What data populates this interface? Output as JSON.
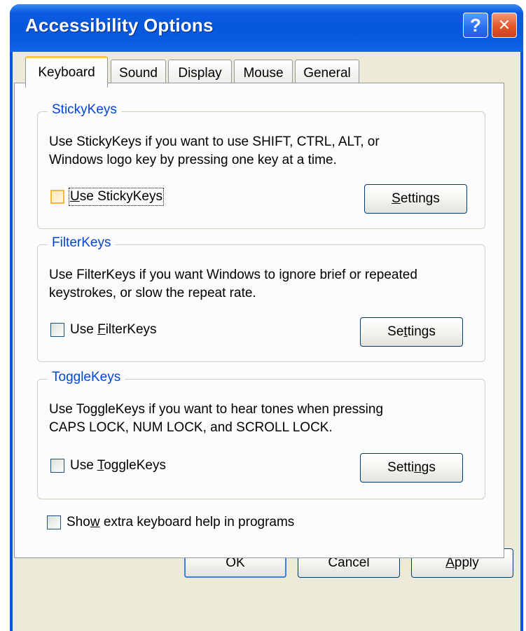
{
  "window": {
    "title": "Accessibility Options"
  },
  "titlebar": {
    "help_glyph": "?",
    "close_glyph": "✕"
  },
  "tabs": [
    {
      "label": "Keyboard",
      "active": true
    },
    {
      "label": "Sound",
      "active": false
    },
    {
      "label": "Display",
      "active": false
    },
    {
      "label": "Mouse",
      "active": false
    },
    {
      "label": "General",
      "active": false
    }
  ],
  "stickykeys": {
    "legend": "StickyKeys",
    "desc_line1": "Use StickyKeys if you want to use SHIFT, CTRL, ALT, or",
    "desc_line2": "Windows logo key by pressing one key at a time.",
    "checkbox": {
      "pre": "",
      "key": "U",
      "post": "se StickyKeys",
      "checked": false
    },
    "settings": {
      "pre": "",
      "key": "S",
      "post": "ettings"
    }
  },
  "filterkeys": {
    "legend": "FilterKeys",
    "desc_line1": "Use FilterKeys if you want Windows to ignore brief or repeated",
    "desc_line2": "keystrokes, or slow the repeat rate.",
    "checkbox": {
      "pre": "Use ",
      "key": "F",
      "post": "ilterKeys",
      "checked": false
    },
    "settings": {
      "pre": "Se",
      "key": "t",
      "post": "tings"
    }
  },
  "togglekeys": {
    "legend": "ToggleKeys",
    "desc_line1": "Use ToggleKeys if you want to hear tones when pressing",
    "desc_line2": "CAPS LOCK, NUM LOCK, and SCROLL LOCK.",
    "checkbox": {
      "pre": "Use ",
      "key": "T",
      "post": "oggleKeys",
      "checked": false
    },
    "settings": {
      "pre": "Setti",
      "key": "n",
      "post": "gs"
    }
  },
  "extra_help": {
    "pre": "Sho",
    "key": "w",
    "post": " extra keyboard help in programs",
    "checked": false
  },
  "buttons": {
    "ok": "OK",
    "cancel": "Cancel",
    "apply": {
      "pre": "",
      "key": "A",
      "post": "pply"
    }
  },
  "colors": {
    "titlebar": "#0054e3",
    "dialog_bg": "#ece9d8",
    "group_legend": "#0046d5",
    "tab_highlight": "#ffc83c"
  }
}
